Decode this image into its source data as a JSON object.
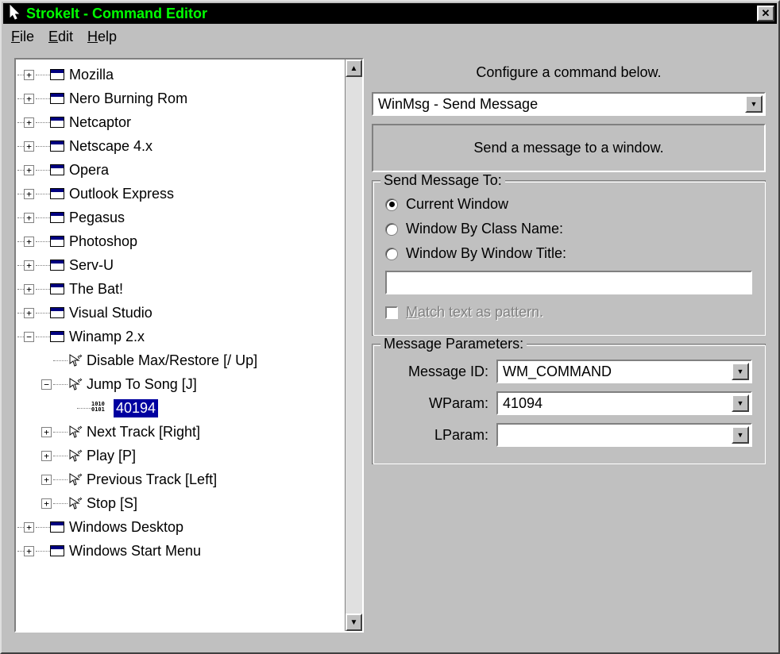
{
  "window": {
    "title": "StrokeIt - Command Editor"
  },
  "menu": {
    "file": "File",
    "edit": "Edit",
    "help": "Help"
  },
  "tree": {
    "apps": [
      "Mozilla",
      "Nero Burning Rom",
      "Netcaptor",
      "Netscape 4.x",
      "Opera",
      "Outlook Express",
      "Pegasus",
      "Photoshop",
      "Serv-U",
      "The Bat!",
      "Visual Studio"
    ],
    "winamp": {
      "label": "Winamp 2.x",
      "items": {
        "disable": "Disable Max/Restore [/ Up]",
        "jump": "Jump To Song [J]",
        "selected": "40194",
        "next": "Next Track [Right]",
        "play": "Play [P]",
        "prev": "Previous Track [Left]",
        "stop": "Stop [S]"
      }
    },
    "after": [
      "Windows Desktop",
      "Windows Start Menu"
    ]
  },
  "right": {
    "configure": "Configure a command below.",
    "commandSelect": "WinMsg - Send Message",
    "description": "Send a message to a window.",
    "sendTo": {
      "legend": "Send Message To:",
      "current": "Current Window",
      "byClass": "Window By Class Name:",
      "byTitle": "Window By Window Title:",
      "match": "Match text as pattern."
    },
    "params": {
      "legend": "Message Parameters:",
      "msgIdLabel": "Message ID:",
      "msgId": "WM_COMMAND",
      "wparamLabel": "WParam:",
      "wparam": "41094",
      "lparamLabel": "LParam:",
      "lparam": ""
    }
  }
}
